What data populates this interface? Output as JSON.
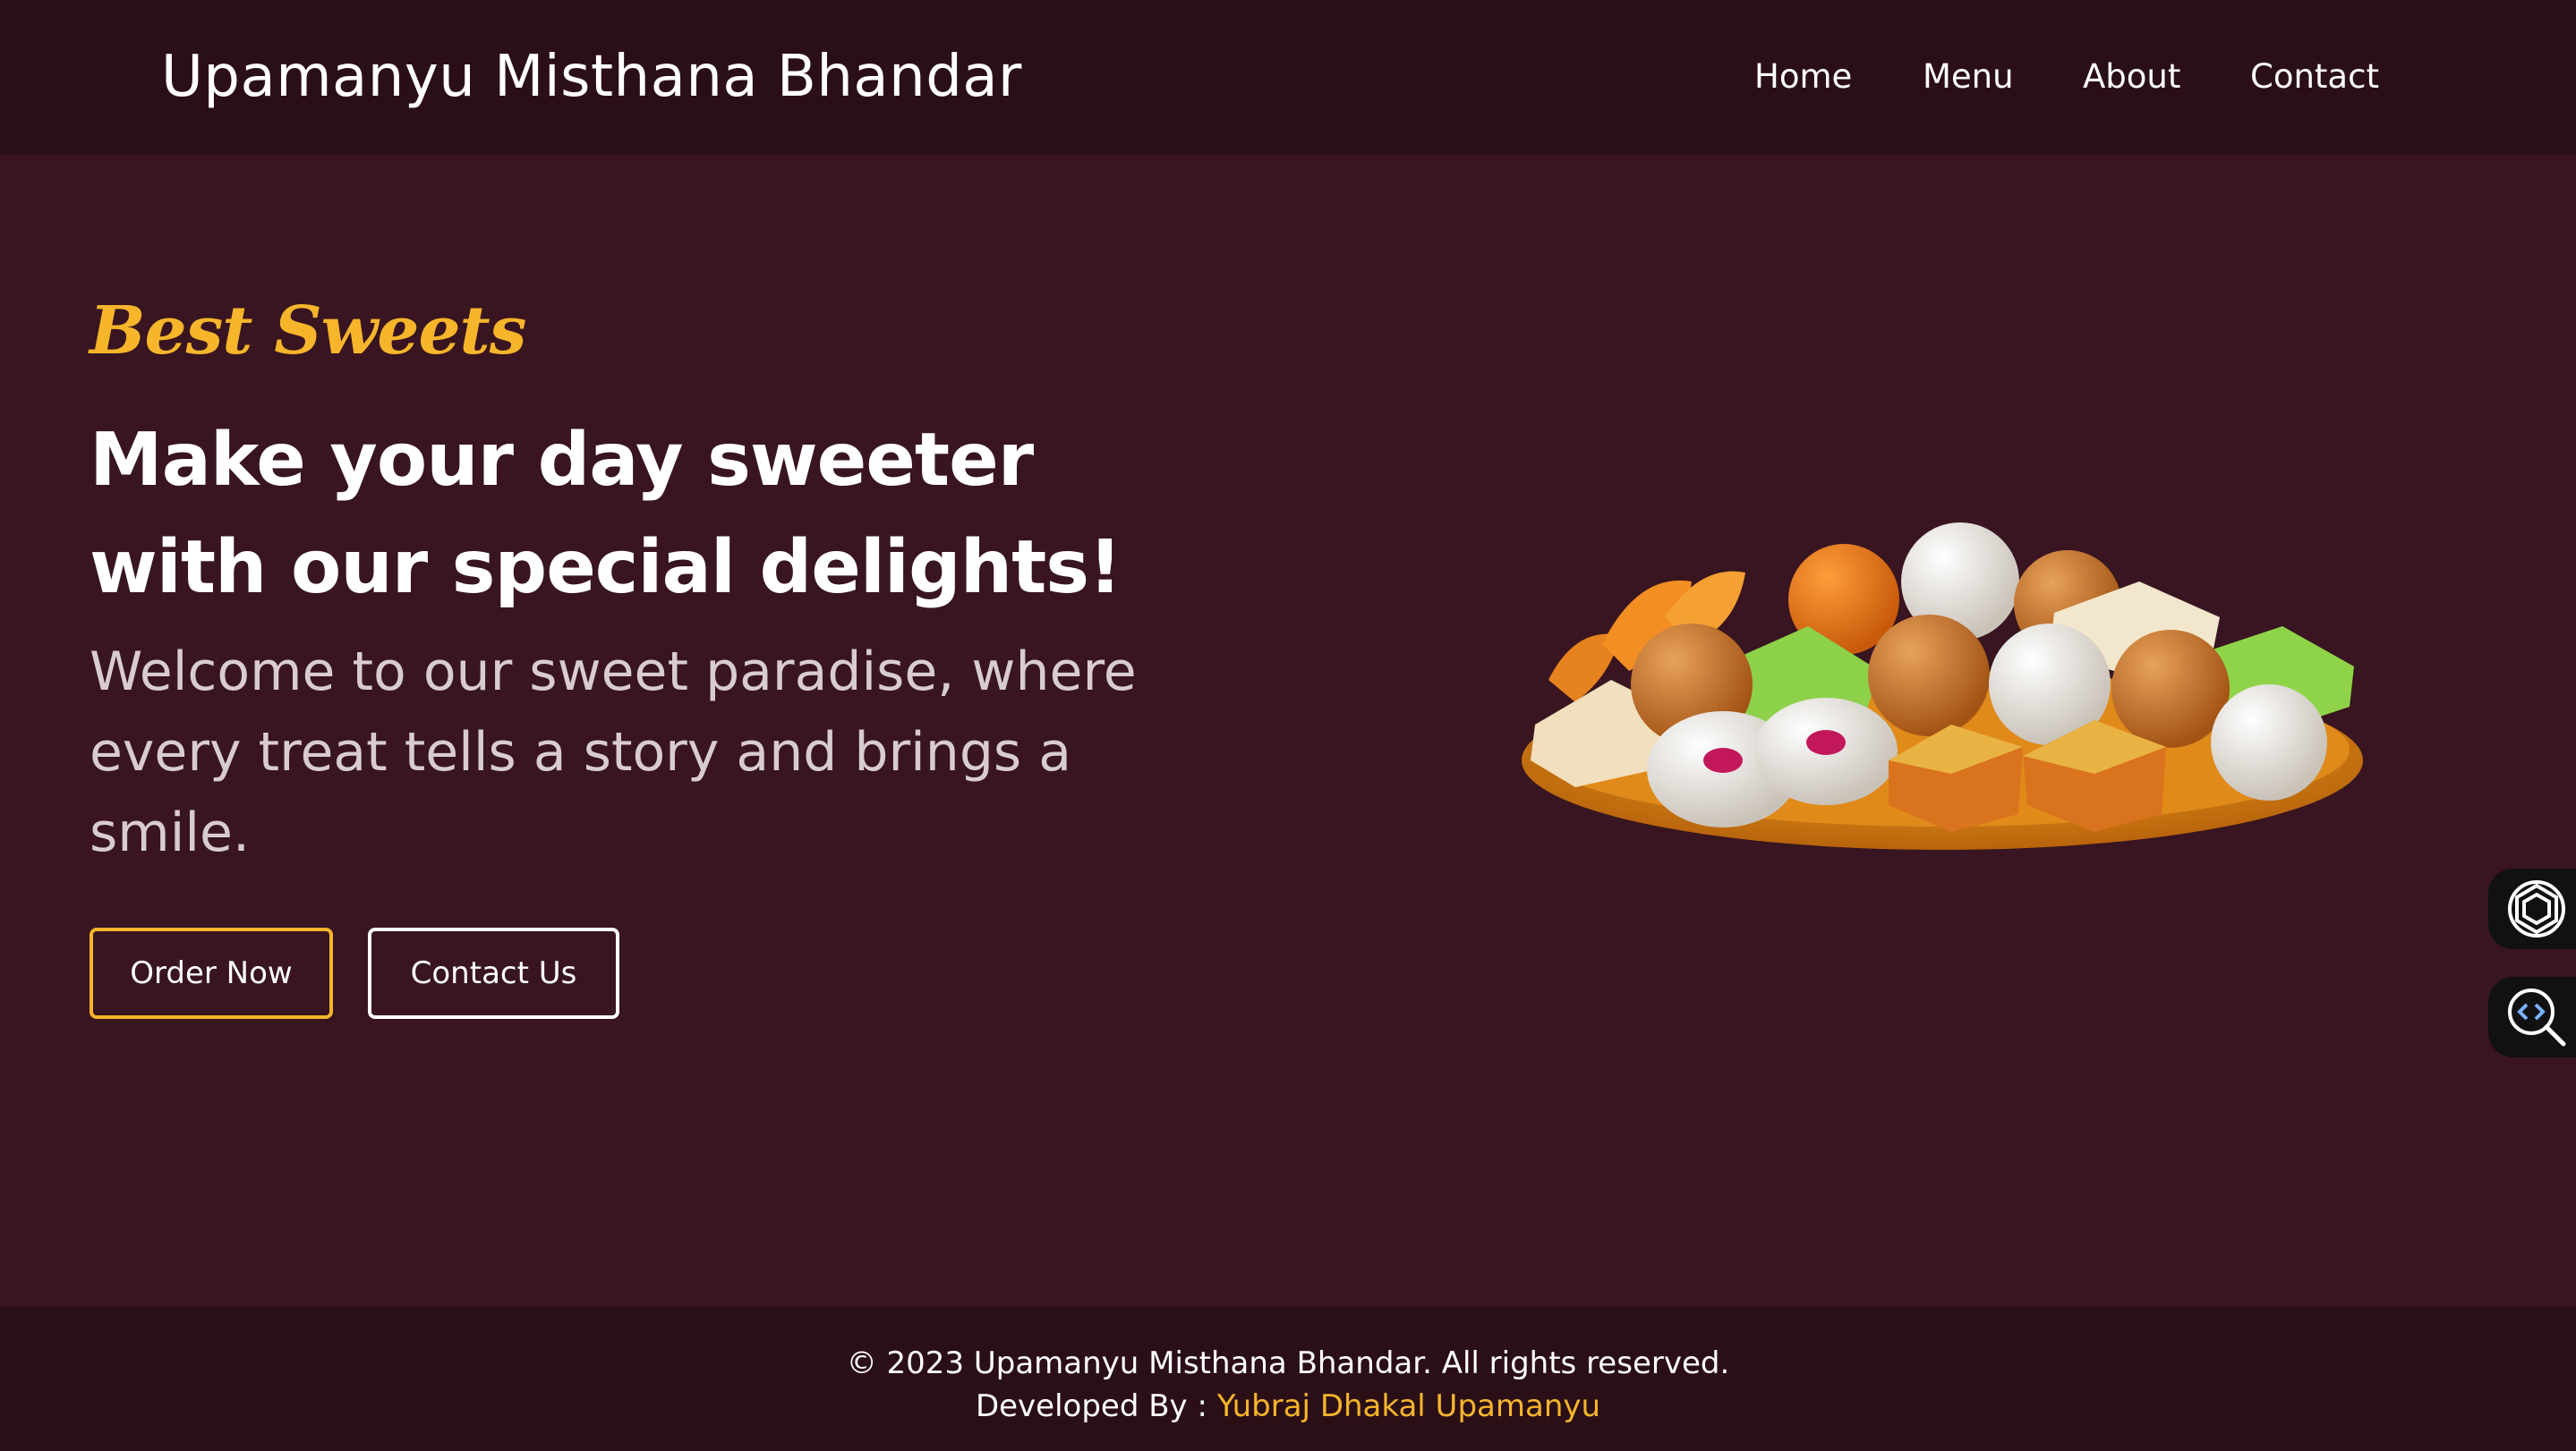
{
  "header": {
    "brand": "Upamanyu Misthana Bhandar",
    "nav": [
      {
        "label": "Home"
      },
      {
        "label": "Menu"
      },
      {
        "label": "About"
      },
      {
        "label": "Contact"
      }
    ]
  },
  "hero": {
    "tagline": "Best Sweets",
    "title": "Make your day sweeter with our special delights!",
    "description": "Welcome to our sweet paradise, where every treat tells a story and brings a smile.",
    "buttons": {
      "order": "Order Now",
      "contact": "Contact Us"
    },
    "image_icon": "sweets-platter-image"
  },
  "side_widgets": [
    {
      "icon": "ai-assistant-icon"
    },
    {
      "icon": "code-inspect-icon"
    }
  ],
  "footer": {
    "copyright": "© 2023 Upamanyu Misthana Bhandar. All rights reserved.",
    "developer_prefix": "Developed By :",
    "developer_name": "Yubraj Dhakal Upamanyu"
  },
  "colors": {
    "background": "#381520",
    "header_footer": "#2b0f17",
    "accent": "#f6b52b",
    "text": "#ffffff",
    "muted_text": "#d9cccf"
  }
}
